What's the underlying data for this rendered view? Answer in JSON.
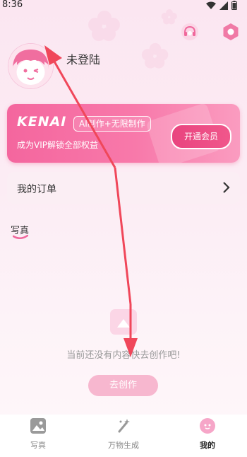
{
  "status_bar": {
    "time": "8:36"
  },
  "header": {
    "headset_icon": "headset-icon",
    "settings_icon": "settings-icon"
  },
  "profile": {
    "username": "未登陆"
  },
  "vip_card": {
    "brand": "KENAI",
    "tag": "AI制作+无限制作",
    "description": "成为VIP解锁全部权益",
    "button": "开通会员"
  },
  "orders": {
    "label": "我的订单"
  },
  "section": {
    "title": "写真"
  },
  "empty_state": {
    "message": "当前还没有内容快去创作吧!",
    "button": "去创作"
  },
  "tabs": [
    {
      "label": "写真",
      "icon": "photo-icon",
      "active": false
    },
    {
      "label": "万物生成",
      "icon": "magic-wand-icon",
      "active": false
    },
    {
      "label": "我的",
      "icon": "my-icon",
      "active": true
    }
  ],
  "colors": {
    "accent": "#f4669e",
    "arrow": "#f0475a",
    "active_tab": "#222222",
    "inactive_tab": "#888888"
  }
}
